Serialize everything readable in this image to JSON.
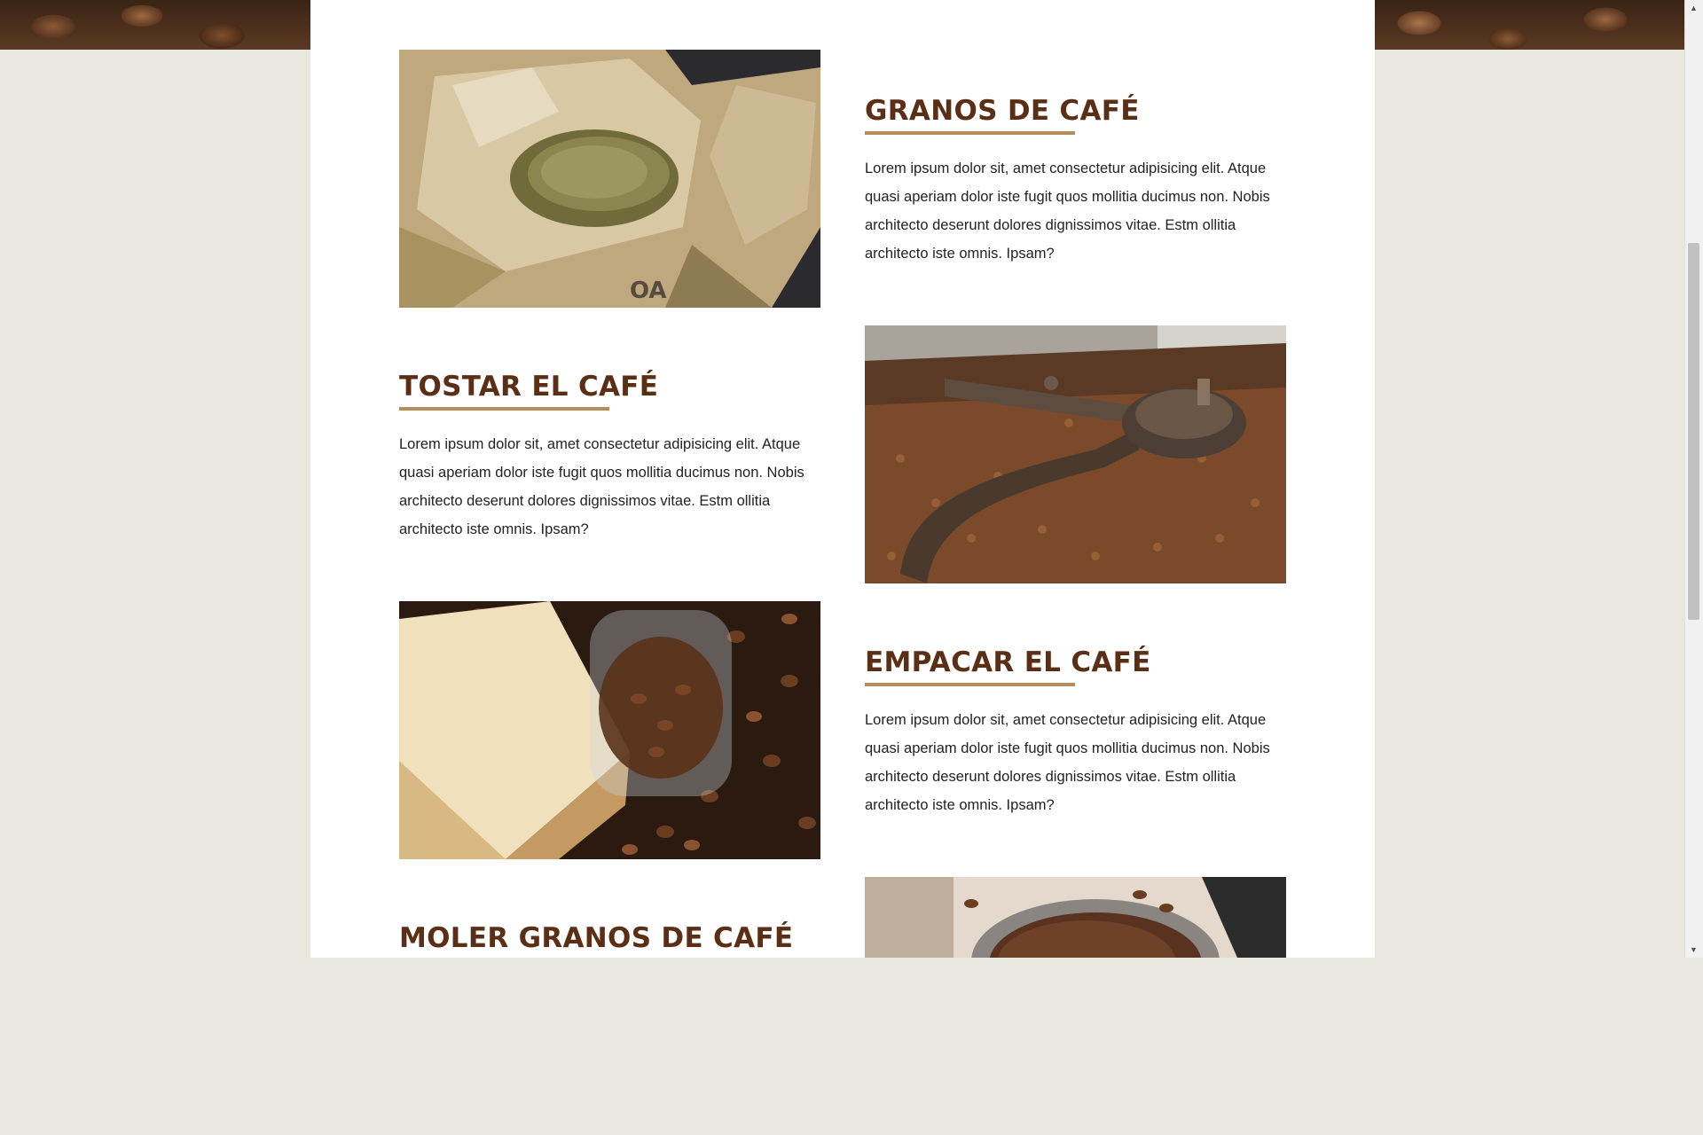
{
  "sections": [
    {
      "title": "GRANOS DE CAFÉ",
      "body": "Lorem ipsum dolor sit, amet consectetur adipisicing elit. Atque quasi aperiam dolor iste fugit quos mollitia ducimus non. Nobis architecto deserunt dolores dignissimos vitae. Estm ollitia architecto iste omnis. Ipsam?",
      "image": "coffee-beans-sack-image"
    },
    {
      "title": "TOSTAR EL CAFÉ",
      "body": "Lorem ipsum dolor sit, amet consectetur adipisicing elit. Atque quasi aperiam dolor iste fugit quos mollitia ducimus non. Nobis architecto deserunt dolores dignissimos vitae. Estm ollitia architecto iste omnis. Ipsam?",
      "image": "coffee-roaster-image"
    },
    {
      "title": "EMPACAR EL CAFÉ",
      "body": "Lorem ipsum dolor sit, amet consectetur adipisicing elit. Atque quasi aperiam dolor iste fugit quos mollitia ducimus non. Nobis architecto deserunt dolores dignissimos vitae. Estm ollitia architecto iste omnis. Ipsam?",
      "image": "coffee-bag-glass-image"
    },
    {
      "title": "MOLER GRANOS DE CAFÉ",
      "image": "ground-coffee-image"
    }
  ],
  "colors": {
    "heading": "#5a2f16",
    "accent": "#b68d5c",
    "page_bg": "#e9e5df"
  }
}
